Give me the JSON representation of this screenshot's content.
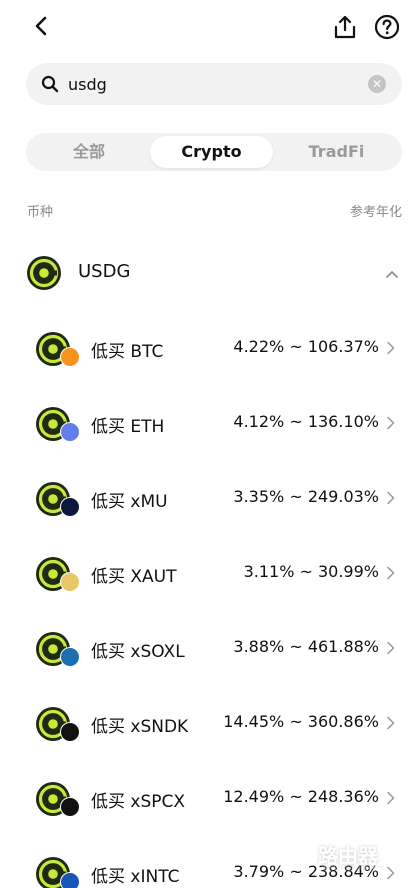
{
  "search": {
    "value": "usdg",
    "placeholder": ""
  },
  "tabs": [
    {
      "label": "全部"
    },
    {
      "label": "Crypto"
    },
    {
      "label": "TradFi"
    }
  ],
  "table": {
    "col_left": "币种",
    "col_right": "参考年化"
  },
  "group": {
    "name": "USDG",
    "expanded": true
  },
  "rows": [
    {
      "name": "低买 BTC",
      "apy": "4.22% ~ 106.37%",
      "badge_color": "#f7931a",
      "badge_icon": "bitcoin-icon"
    },
    {
      "name": "低买 ETH",
      "apy": "4.12% ~ 136.10%",
      "badge_color": "#627eea",
      "badge_icon": "ethereum-icon"
    },
    {
      "name": "低买 xMU",
      "apy": "3.35% ~ 249.03%",
      "badge_color": "#0b1a3a",
      "badge_icon": "micron-icon"
    },
    {
      "name": "低买 XAUT",
      "apy": "3.11% ~ 30.99%",
      "badge_color": "#e9c766",
      "badge_icon": "tether-gold-icon"
    },
    {
      "name": "低买 xSOXL",
      "apy": "3.88% ~ 461.88%",
      "badge_color": "#1a6fb0",
      "badge_icon": "direxion-icon"
    },
    {
      "name": "低买 xSNDK",
      "apy": "14.45% ~ 360.86%",
      "badge_color": "#111111",
      "badge_icon": "sandisk-icon"
    },
    {
      "name": "低买 xSPCX",
      "apy": "12.49% ~ 248.36%",
      "badge_color": "#111111",
      "badge_icon": "spacex-icon"
    },
    {
      "name": "低买 xINTC",
      "apy": "3.79% ~ 238.84%",
      "badge_color": "#1a56b8",
      "badge_icon": "intel-icon"
    }
  ],
  "colors": {
    "usdg_green": "#c8e83a",
    "usdg_dark": "#1f2a12"
  },
  "watermark": {
    "text": "路由器",
    "sub": "www.luyouqi.com"
  }
}
